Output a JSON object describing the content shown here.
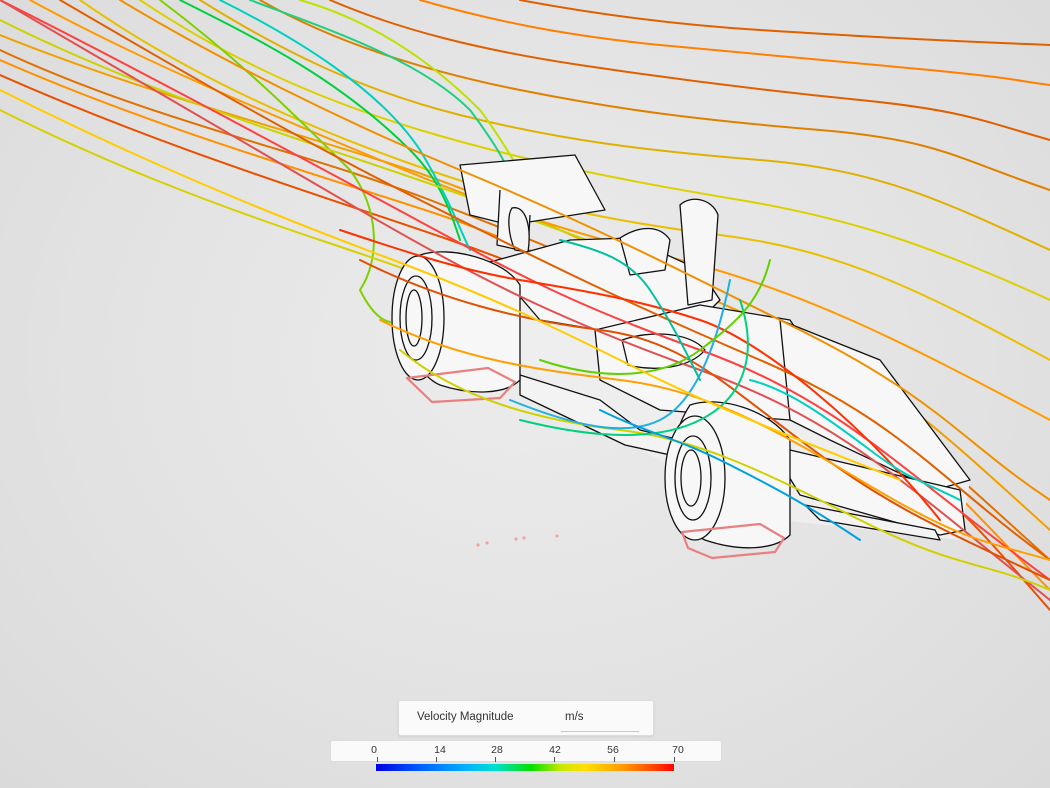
{
  "legend": {
    "quantity": "Velocity Magnitude",
    "unit": "m/s",
    "ticks": [
      "0",
      "14",
      "28",
      "42",
      "56",
      "70"
    ],
    "range": [
      0,
      70
    ]
  },
  "colors": {
    "background": "#e2e2e2",
    "model_face": "#f7f7f7",
    "model_edge": "#111111",
    "ground_contact": "#e88080",
    "colormap": [
      "#0000e0",
      "#0060ff",
      "#00b0ff",
      "#00e0d0",
      "#00e000",
      "#c8e800",
      "#ffe000",
      "#ffa000",
      "#ff5000",
      "#ff0000"
    ]
  },
  "scene": {
    "model": "race-car",
    "visualization": "streamlines"
  }
}
